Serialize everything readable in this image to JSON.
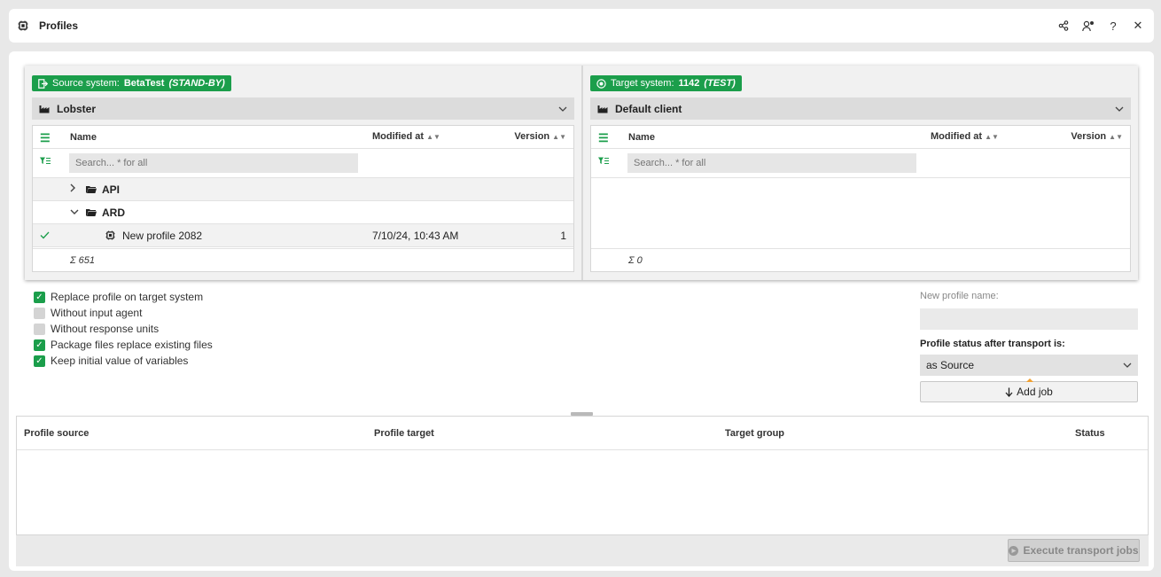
{
  "window": {
    "title": "Profiles",
    "actions": [
      "share-icon",
      "user-settings-icon",
      "help-icon",
      "close-icon"
    ],
    "help_glyph": "?",
    "close_glyph": "✕"
  },
  "source": {
    "badge_prefix": "Source system:",
    "system_name": "BetaTest",
    "system_state": "(STAND-BY)",
    "client": "Lobster",
    "columns": {
      "name": "Name",
      "modified": "Modified at",
      "version": "Version"
    },
    "search_placeholder": "Search... * for all",
    "rows": [
      {
        "type": "folder",
        "name": "API",
        "expanded": false
      },
      {
        "type": "folder",
        "name": "ARD",
        "expanded": true
      },
      {
        "type": "profile",
        "name": "New profile 2082",
        "modified": "7/10/24, 10:43 AM",
        "version": "1",
        "checked": true
      }
    ],
    "sum": "Σ 651"
  },
  "target": {
    "badge_prefix": "Target system:",
    "system_name": "1142",
    "system_state": "(TEST)",
    "client": "Default client",
    "columns": {
      "name": "Name",
      "modified": "Modified at",
      "version": "Version"
    },
    "search_placeholder": "Search... * for all",
    "sum": "Σ 0"
  },
  "options": [
    {
      "label": "Replace profile on target system",
      "checked": true
    },
    {
      "label": "Without input agent",
      "checked": false
    },
    {
      "label": "Without response units",
      "checked": false
    },
    {
      "label": "Package files replace existing files",
      "checked": true
    },
    {
      "label": "Keep initial value of variables",
      "checked": true
    }
  ],
  "side": {
    "new_name_label": "New profile name:",
    "new_name_value": "",
    "status_label": "Profile status after transport is:",
    "status_value": "as Source",
    "add_job_label": "Add job"
  },
  "jobs": {
    "columns": [
      "Profile source",
      "Profile target",
      "Target group",
      "Status"
    ],
    "execute_label": "Execute transport jobs"
  },
  "colors": {
    "accent": "#1b9e4b"
  }
}
